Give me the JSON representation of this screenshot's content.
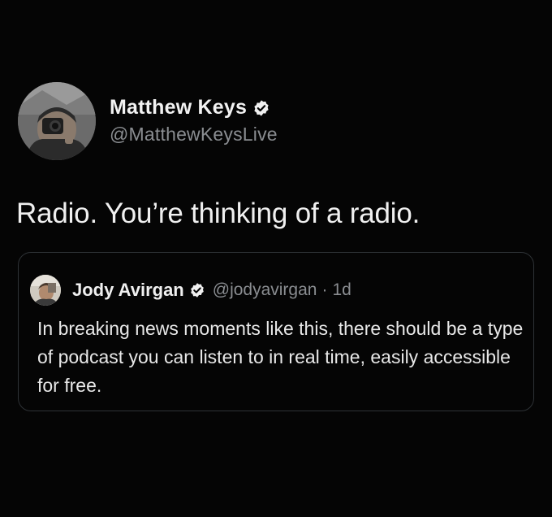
{
  "tweet": {
    "author": {
      "display_name": "Matthew Keys",
      "handle": "@MatthewKeysLive",
      "verified": true
    },
    "text": "Radio. You’re thinking of a radio.",
    "quoted_tweet": {
      "author": {
        "display_name": "Jody Avirgan",
        "handle": "@jodyavirgan",
        "verified": true
      },
      "separator": "·",
      "time": "1d",
      "text": "In breaking news moments like this, there should be a type of podcast you can listen to in real time, easily accessible for free."
    }
  },
  "colors": {
    "background": "#050505",
    "primary_text": "#f0f0f0",
    "secondary_text": "#8a8d91",
    "border": "#2e3236"
  },
  "icons": {
    "verified": "verified-badge-icon"
  }
}
